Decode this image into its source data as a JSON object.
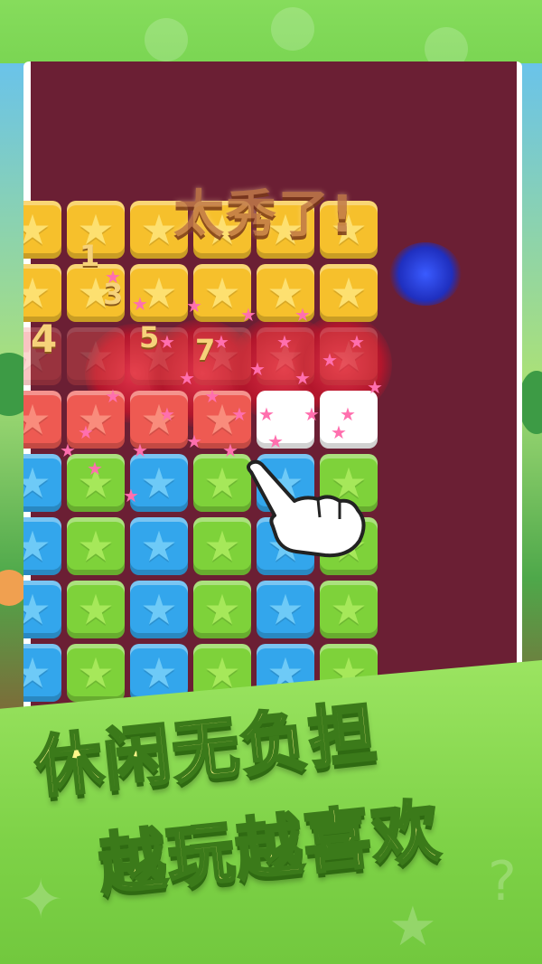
{
  "praise_text": "太秀了!",
  "combo_numbers": [
    "1",
    "3",
    "4",
    "5",
    "7"
  ],
  "headline": {
    "line1": "休闲无负担",
    "line2": "越玩越喜欢"
  },
  "tile_icon": "star-icon",
  "colors": {
    "board_bg": "#6b1f34",
    "yellow": "#f6c02c",
    "red": "#ee5a52",
    "green": "#7ed23a",
    "blue": "#33a6ec",
    "headline_fill": "#fff78a",
    "headline_outline": "#3b7a1a",
    "frame_green": "#6fcf4a"
  },
  "board": {
    "rows": [
      [
        "yellow",
        "yellow",
        "yellow",
        "yellow",
        "yellow",
        "yellow"
      ],
      [
        "yellow",
        "yellow",
        "yellow",
        "yellow",
        "yellow",
        "yellow"
      ],
      [
        "red",
        "red",
        "red",
        "red",
        "red",
        "red"
      ],
      [
        "red",
        "red",
        "red",
        "red",
        "white",
        "white"
      ],
      [
        "blue",
        "green",
        "blue",
        "green",
        "blue",
        "green"
      ],
      [
        "blue",
        "green",
        "blue",
        "green",
        "blue",
        "green"
      ],
      [
        "blue",
        "green",
        "blue",
        "green",
        "blue",
        "green"
      ],
      [
        "blue",
        "green",
        "blue",
        "green",
        "blue",
        "green"
      ],
      [
        "blue",
        "green",
        "blue",
        "green",
        "blue",
        "green"
      ]
    ]
  }
}
